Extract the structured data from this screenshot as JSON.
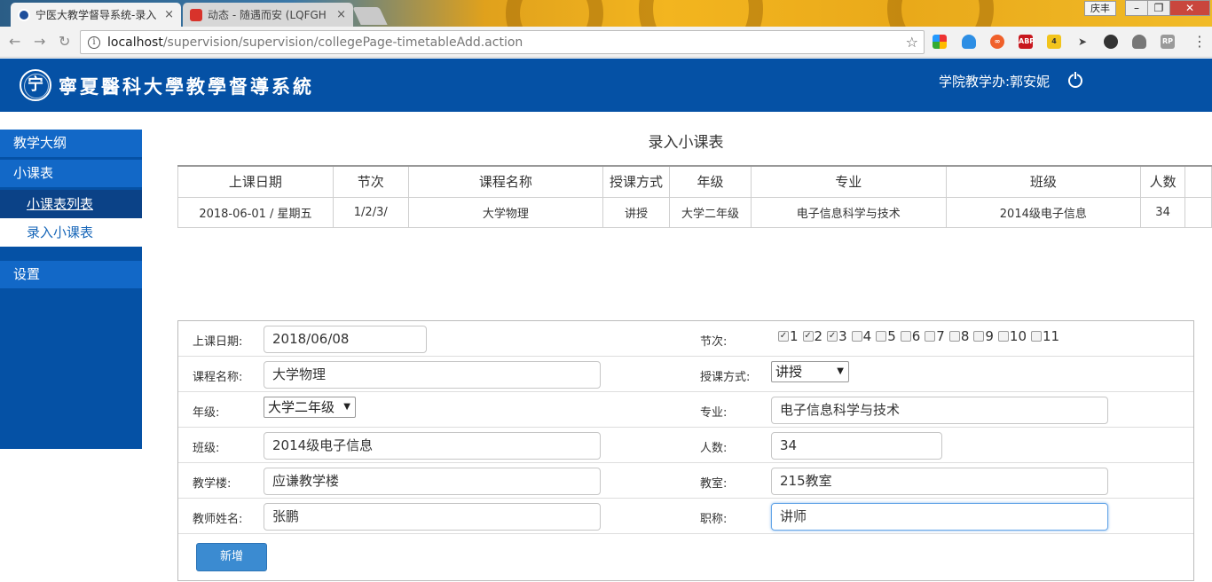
{
  "browser": {
    "tabs": [
      {
        "title": "宁医大教学督导系统-录入",
        "active": true
      },
      {
        "title": "动态 - 随遇而安 (LQFGH",
        "active": false
      }
    ],
    "tab_close_glyph": "×",
    "user_label": "庆丰",
    "window_buttons": [
      "–",
      "❐",
      "✕"
    ],
    "url_host": "localhost",
    "url_path": "/supervision/supervision/collegePage-timetableAdd.action",
    "extension_badge": "4"
  },
  "header": {
    "logo_char": "宁",
    "site_title": "寧夏醫科大學教學督導系統",
    "user": "学院教学办:郭安妮"
  },
  "sidebar": {
    "items": [
      {
        "label": "教学大纲"
      },
      {
        "label": "小课表"
      },
      {
        "label": "设置"
      }
    ],
    "subitems": [
      {
        "label": "小课表列表",
        "active": true
      },
      {
        "label": "录入小课表",
        "active": false
      }
    ]
  },
  "main": {
    "title": "录入小课表",
    "table": {
      "headers": [
        "上课日期",
        "节次",
        "课程名称",
        "授课方式",
        "年级",
        "专业",
        "班级",
        "人数"
      ],
      "rows": [
        [
          "2018-06-01 / 星期五",
          "1/2/3/",
          "大学物理",
          "讲授",
          "大学二年级",
          "电子信息科学与技术",
          "2014级电子信息",
          "34"
        ]
      ]
    },
    "form": {
      "date_label": "上课日期:",
      "date_value": "2018/06/08",
      "sessions_label": "节次:",
      "sessions": [
        {
          "label": "1",
          "checked": true
        },
        {
          "label": "2",
          "checked": true
        },
        {
          "label": "3",
          "checked": true
        },
        {
          "label": "4",
          "checked": false
        },
        {
          "label": "5",
          "checked": false
        },
        {
          "label": "6",
          "checked": false
        },
        {
          "label": "7",
          "checked": false
        },
        {
          "label": "8",
          "checked": false
        },
        {
          "label": "9",
          "checked": false
        },
        {
          "label": "10",
          "checked": false
        },
        {
          "label": "11",
          "checked": false
        }
      ],
      "check_glyph": "✓",
      "select_caret": "▼",
      "course_label": "课程名称:",
      "course_value": "大学物理",
      "method_label": "授课方式:",
      "method_value": "讲授",
      "grade_label": "年级:",
      "grade_value": "大学二年级",
      "major_label": "专业:",
      "major_value": "电子信息科学与技术",
      "class_label": "班级:",
      "class_value": "2014级电子信息",
      "count_label": "人数:",
      "count_value": "34",
      "building_label": "教学楼:",
      "building_value": "应谦教学楼",
      "room_label": "教室:",
      "room_value": "215教室",
      "teacher_label": "教师姓名:",
      "teacher_value": "张鹏",
      "rank_label": "职称:",
      "rank_value": "讲师",
      "submit_label": "新增"
    }
  },
  "colors": {
    "header_blue": "#0551a5",
    "sidebar_item": "#1268c7",
    "button_blue": "#3b8bd1"
  }
}
